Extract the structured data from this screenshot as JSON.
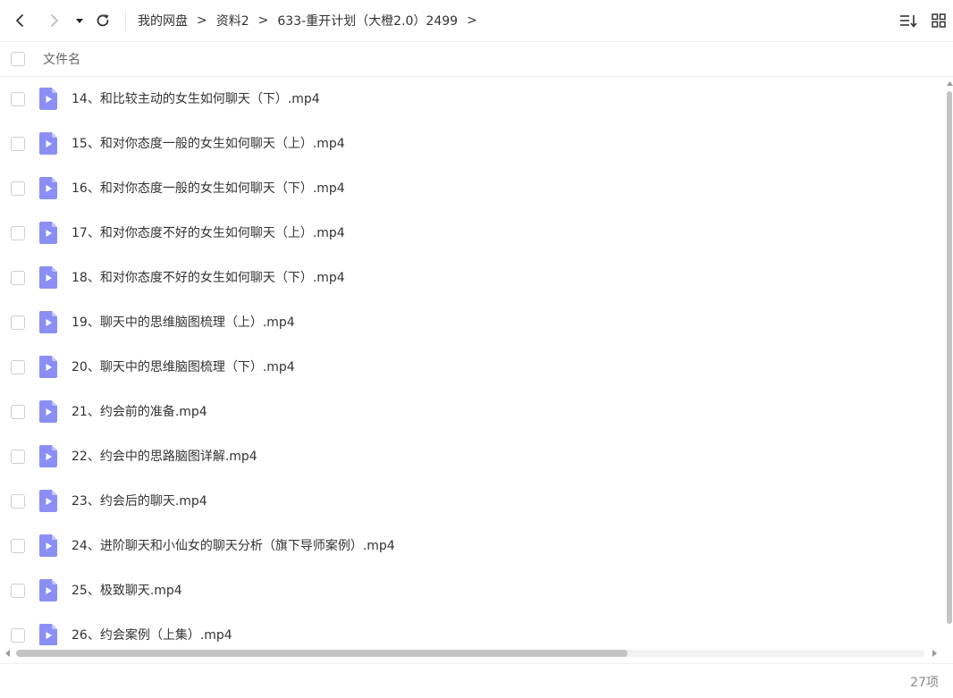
{
  "toolbar": {
    "back_icon": "chevron-left-icon",
    "forward_icon": "chevron-right-icon",
    "history_icon": "caret-down-icon",
    "refresh_icon": "refresh-icon",
    "sort_icon": "sort-icon",
    "grid_icon": "grid-view-icon"
  },
  "breadcrumb": {
    "items": [
      "我的网盘",
      "资料2",
      "633-重开计划（大橙2.0）2499"
    ],
    "separator": ">"
  },
  "header": {
    "name_label": "文件名"
  },
  "files": [
    {
      "name": "14、和比较主动的女生如何聊天（下）.mp4"
    },
    {
      "name": "15、和对你态度一般的女生如何聊天（上）.mp4"
    },
    {
      "name": "16、和对你态度一般的女生如何聊天（下）.mp4"
    },
    {
      "name": "17、和对你态度不好的女生如何聊天（上）.mp4"
    },
    {
      "name": "18、和对你态度不好的女生如何聊天（下）.mp4"
    },
    {
      "name": "19、聊天中的思维脑图梳理（上）.mp4"
    },
    {
      "name": "20、聊天中的思维脑图梳理（下）.mp4"
    },
    {
      "name": "21、约会前的准备.mp4"
    },
    {
      "name": "22、约会中的思路脑图详解.mp4"
    },
    {
      "name": "23、约会后的聊天.mp4"
    },
    {
      "name": "24、进阶聊天和小仙女的聊天分析（旗下导师案例）.mp4"
    },
    {
      "name": "25、极致聊天.mp4"
    },
    {
      "name": "26、约会案例（上集）.mp4"
    }
  ],
  "status": {
    "count_label": "27项"
  },
  "colors": {
    "file_icon": "#8b8ff5",
    "file_icon_fold": "#c3c5fb",
    "text": "#333333"
  }
}
